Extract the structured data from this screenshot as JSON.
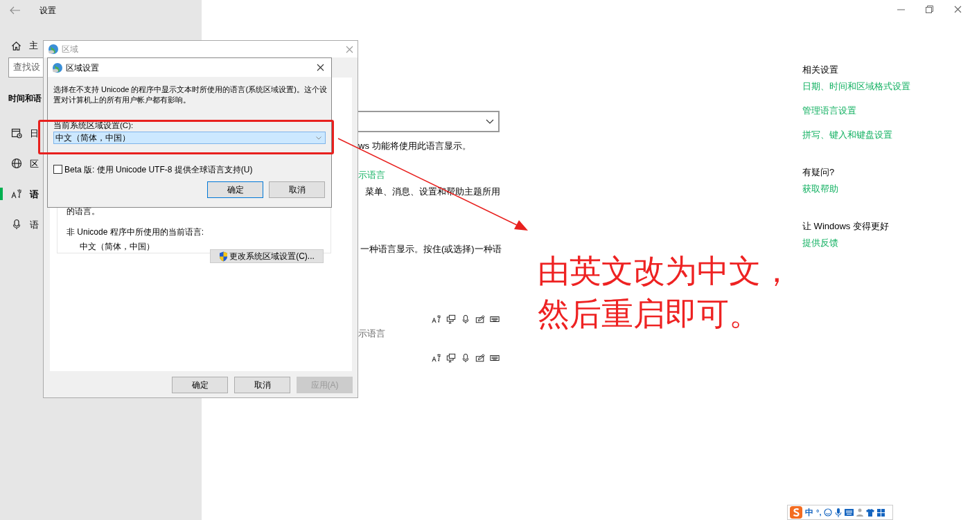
{
  "window": {
    "title": "设置"
  },
  "sidebar": {
    "home": "主",
    "search_placeholder": "查找设",
    "section": "时间和语",
    "items": [
      {
        "kind": "calendar",
        "label": "日",
        "selected": false
      },
      {
        "kind": "globe",
        "label": "区",
        "selected": false
      },
      {
        "kind": "language",
        "label": "语",
        "selected": true
      },
      {
        "kind": "mic",
        "label": "语",
        "selected": false
      }
    ]
  },
  "main": {
    "dropdown_note": "ws 功能将使用此语言显示。",
    "link": "示语言",
    "description": "菜单、消息、设置和帮助主题所用",
    "hint": "一种语言显示。按住(或选择)一种语",
    "language_caption": "示语言"
  },
  "related": [
    {
      "title": "相关设置",
      "links": [
        "日期、时间和区域格式设置",
        "管理语言设置",
        "拼写、键入和键盘设置"
      ]
    },
    {
      "title": "有疑问?",
      "links": [
        "获取帮助"
      ]
    },
    {
      "title": "让 Windows 变得更好",
      "links": [
        "提供反馈"
      ]
    }
  ],
  "region_dialog": {
    "title": "区域",
    "partial_text": "的语言。",
    "label": "非 Unicode 程序中所使用的当前语言:",
    "value": "中文（简体，中国）",
    "change_button": "更改系统区域设置(C)...",
    "buttons": [
      {
        "label": "确定",
        "disabled": false
      },
      {
        "label": "取消",
        "disabled": false
      },
      {
        "label": "应用(A)",
        "disabled": true
      }
    ]
  },
  "locale_dialog": {
    "title": "区域设置",
    "description": "选择在不支持 Unicode 的程序中显示文本时所使用的语言(系统区域设置)。这个设置对计算机上的所有用户帐户都有影响。",
    "label": "当前系统区域设置(C):",
    "value": "中文（简体，中国）",
    "beta": {
      "label": "Beta 版: 使用 Unicode UTF-8 提供全球语言支持(U)",
      "checked": false
    },
    "buttons": [
      {
        "label": "确定",
        "default": true
      },
      {
        "label": "取消",
        "default": false
      }
    ]
  },
  "annotation": {
    "lines": [
      "由英文改为中文，",
      "然后重启即可。"
    ]
  },
  "ime": {
    "mode": "中",
    "punctuation": "°,"
  }
}
